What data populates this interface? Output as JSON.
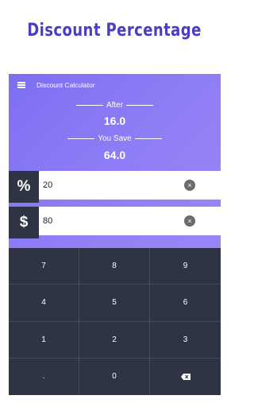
{
  "banner": {
    "title": "Discount Percentage"
  },
  "appbar": {
    "title": "Discount Calculator",
    "menu_icon": "hamburger-menu-icon"
  },
  "results": {
    "after_label": "After",
    "after_value": "16.0",
    "save_label": "You Save",
    "save_value": "64.0"
  },
  "inputs": {
    "percent": {
      "icon": "%",
      "value": "20",
      "clear_icon": "×"
    },
    "price": {
      "icon": "$",
      "value": "80",
      "clear_icon": "×"
    }
  },
  "keypad": {
    "keys": [
      "7",
      "8",
      "9",
      "4",
      "5",
      "6",
      "1",
      "2",
      "3",
      ".",
      "0"
    ],
    "backspace_icon": "backspace-icon"
  },
  "colors": {
    "brand_title": "#4a3ec4",
    "panel_gradient_start": "#7c6ff0",
    "panel_gradient_end": "#9a86f7",
    "keypad_bg": "#2f3444"
  }
}
